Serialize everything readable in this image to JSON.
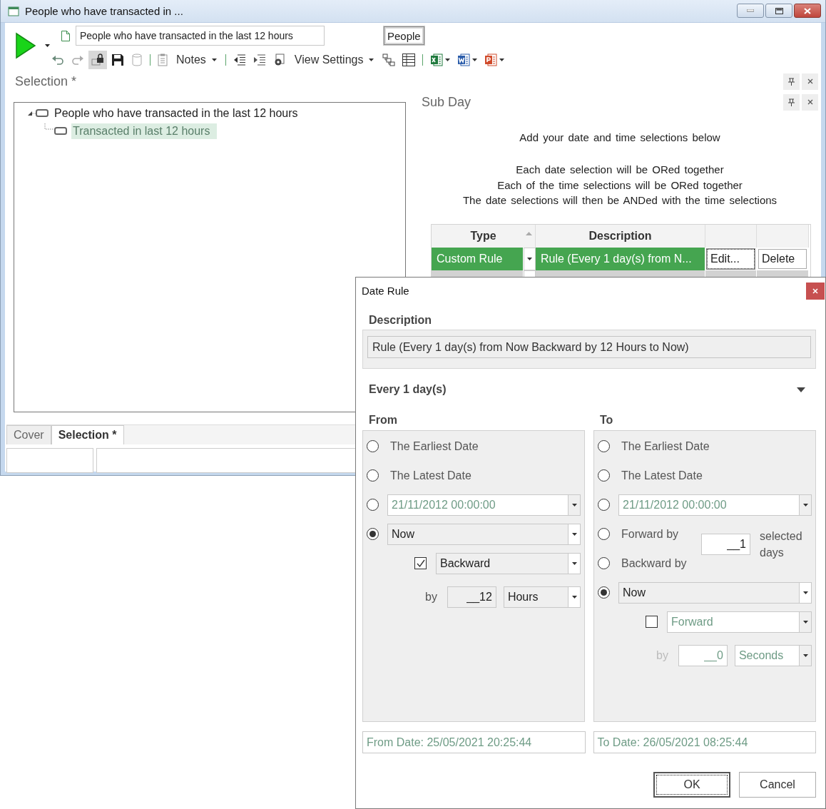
{
  "window": {
    "title": "People who have transacted in ..."
  },
  "toolbar": {
    "name_field": {
      "value": "People who have transacted in the last 12 hours"
    },
    "people_button": "People",
    "notes_button": "Notes",
    "view_settings_button": "View Settings"
  },
  "selection_panel": {
    "title": "Selection *",
    "tree": [
      {
        "label": "People who have transacted in the last 12 hours",
        "expanded": true,
        "selected": false,
        "children": [
          {
            "label": "Transacted in last 12 hours",
            "selected": true
          }
        ]
      }
    ]
  },
  "tabs": [
    {
      "label": "Cover",
      "selected": false
    },
    {
      "label": "Selection *",
      "selected": true
    }
  ],
  "sub_day": {
    "title": "Sub Day",
    "intro": "Add your date and time selections below",
    "notes": [
      "Each date selection will be ORed together",
      "Each of the time selections will be ORed together",
      "The date selections will then be ANDed with the time selections"
    ],
    "table": {
      "columns": [
        {
          "label": "Type",
          "sorted": true
        },
        {
          "label": "Description",
          "sorted": false
        }
      ],
      "rows": [
        {
          "type": "Custom Rule",
          "description": "Rule (Every 1 day(s) from N...",
          "edit": "Edit...",
          "delete": "Delete",
          "selected": true
        },
        {
          "selected": false
        }
      ]
    }
  },
  "dialog": {
    "title": "Date Rule",
    "description_label": "Description",
    "description": "Rule (Every 1 day(s) from Now Backward by 12 Hours to Now)",
    "frequency": {
      "label": "Every 1 day(s)",
      "expanded": false
    },
    "from": {
      "label": "From",
      "options": [
        {
          "kind": "preset",
          "label": "The Earliest Date",
          "selected": false
        },
        {
          "kind": "preset",
          "label": "The Latest Date",
          "selected": false
        },
        {
          "kind": "date",
          "value": "21/11/2012 00:00:00",
          "selected": false
        },
        {
          "kind": "relative",
          "value": "Now",
          "selected": true,
          "direction": {
            "value": "Backward",
            "checked": true
          },
          "by_label": "by",
          "amount": "__12",
          "unit": "Hours"
        }
      ]
    },
    "to": {
      "label": "To",
      "options": [
        {
          "kind": "preset",
          "label": "The Earliest Date",
          "selected": false
        },
        {
          "kind": "preset",
          "label": "The Latest Date",
          "selected": false
        },
        {
          "kind": "date",
          "value": "21/11/2012 00:00:00",
          "selected": false
        },
        {
          "kind": "offset",
          "choices": [
            {
              "label": "Forward by",
              "selected": false
            },
            {
              "label": "Backward by",
              "selected": false
            }
          ],
          "amount": "__1",
          "unit_label": "selected days"
        },
        {
          "kind": "relative",
          "value": "Now",
          "selected": true,
          "direction": {
            "value": "Forward",
            "checked": false
          },
          "by_label": "by",
          "amount": "__0",
          "unit": "Seconds"
        }
      ]
    },
    "from_date": "From Date: 25/05/2021 20:25:44",
    "to_date": "To Date: 26/05/2021 08:25:44",
    "buttons": [
      {
        "label": "OK",
        "default": true
      },
      {
        "label": "Cancel",
        "default": false
      }
    ]
  }
}
